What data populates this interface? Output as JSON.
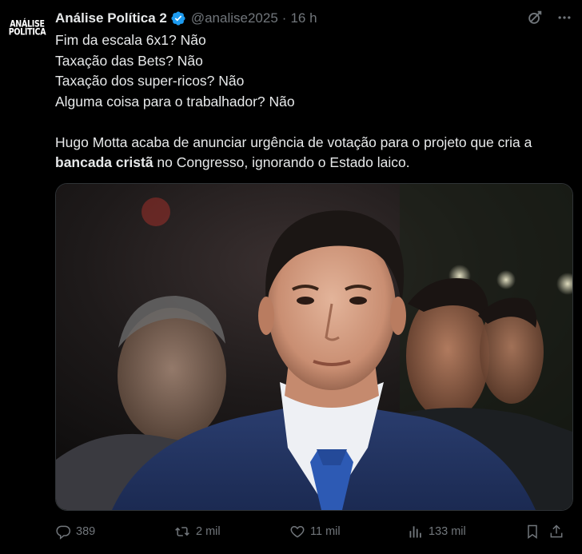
{
  "post": {
    "avatar": {
      "line1": "ANÁLISE",
      "line2": "POLÍTICA"
    },
    "author_name": "Análise Política 2",
    "handle": "@analise2025",
    "separator": "·",
    "time": "16 h",
    "lines": [
      "Fim da escala 6x1? Não",
      "Taxação das Bets? Não",
      "Taxação dos super-ricos? Não",
      "Alguma coisa para o trabalhador? Não"
    ],
    "paragraph": {
      "text_before": "Hugo Motta acaba de anunciar urgência de votação para o projeto que cria a ",
      "bold": "bancada cristã",
      "text_after": " no Congresso, ignorando o Estado laico."
    },
    "media": {
      "type": "photo"
    },
    "stats": {
      "replies": "389",
      "reposts": "2 mil",
      "likes": "11 mil",
      "views": "133 mil"
    }
  },
  "icons": {
    "verified": "verified-badge-icon",
    "grok": "grok-icon",
    "more": "more-dots-icon",
    "reply": "reply-icon",
    "repost": "repost-icon",
    "like": "heart-icon",
    "views": "views-chart-icon",
    "bookmark": "bookmark-icon",
    "share": "share-icon"
  },
  "colors": {
    "background": "#000000",
    "text": "#e7e9ea",
    "muted": "#71767b",
    "verified": "#1d9bf0",
    "border": "#2f3336"
  }
}
